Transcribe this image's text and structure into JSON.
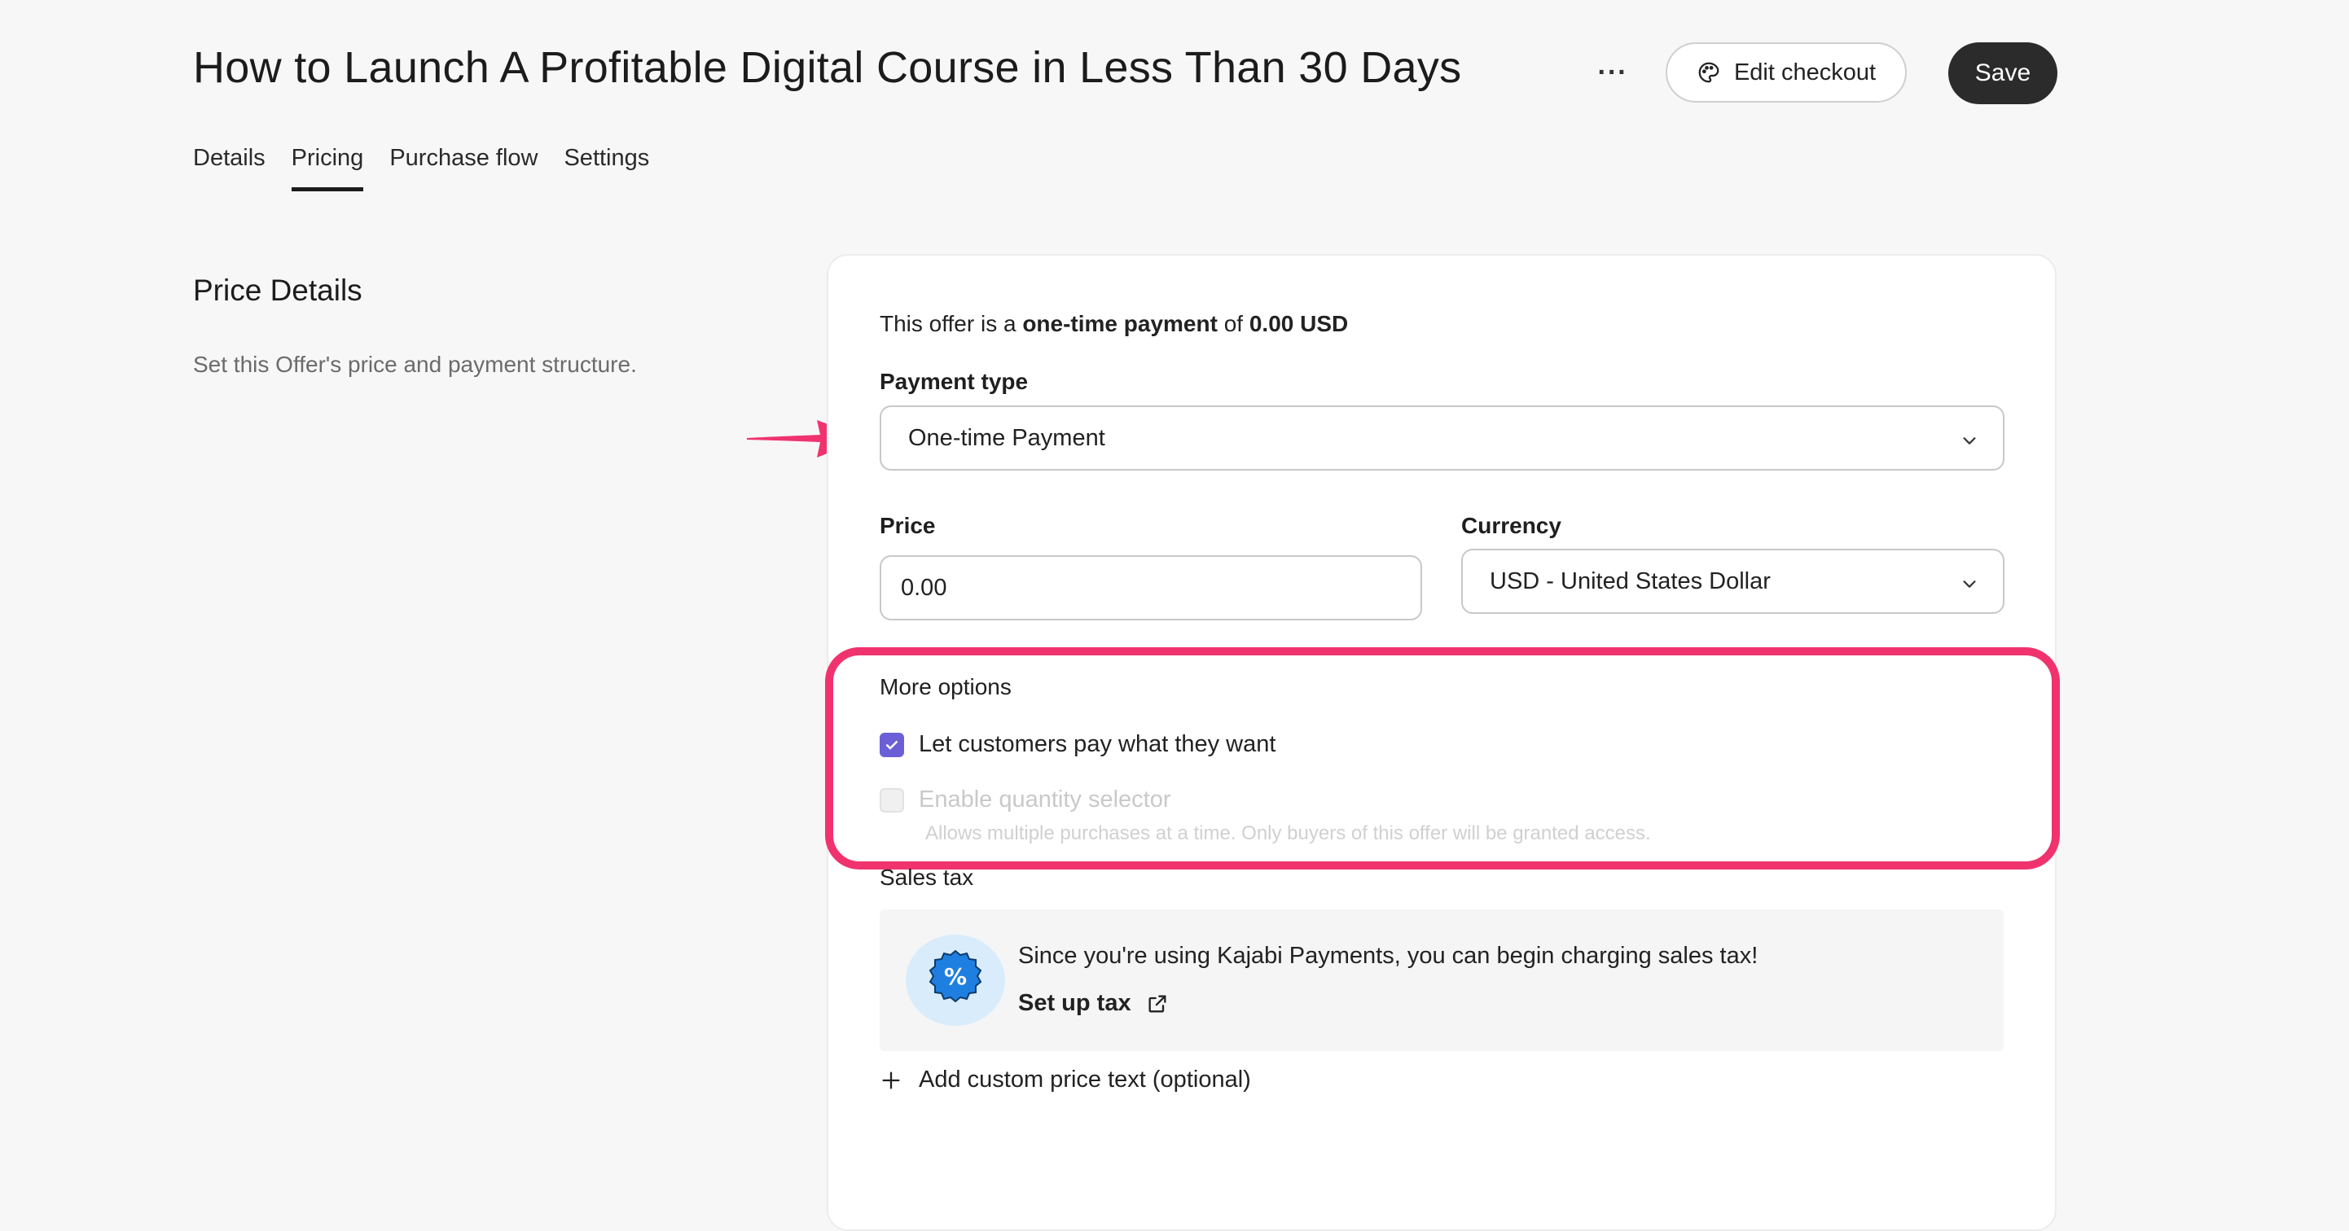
{
  "header": {
    "title": "How to Launch A Profitable Digital Course in Less Than 30 Days",
    "more_label": "···",
    "edit_checkout_label": "Edit checkout",
    "save_label": "Save"
  },
  "tabs": [
    {
      "label": "Details",
      "active": false
    },
    {
      "label": "Pricing",
      "active": true
    },
    {
      "label": "Purchase flow",
      "active": false
    },
    {
      "label": "Settings",
      "active": false
    }
  ],
  "section": {
    "title": "Price Details",
    "description": "Set this Offer's price and payment structure."
  },
  "summary": {
    "prefix": "This offer is a ",
    "type": "one-time payment",
    "middle": " of ",
    "amount": "0.00 USD"
  },
  "payment_type": {
    "label": "Payment type",
    "value": "One-time Payment"
  },
  "price": {
    "label": "Price",
    "value": "0.00"
  },
  "currency": {
    "label": "Currency",
    "value": "USD - United States Dollar"
  },
  "more_options": {
    "title": "More options",
    "pay_what_you_want": {
      "label": "Let customers pay what they want",
      "checked": true
    },
    "quantity_selector": {
      "label": "Enable quantity selector",
      "checked": false,
      "disabled": true,
      "help": "Allows multiple purchases at a time. Only buyers of this offer will be granted access."
    }
  },
  "sales_tax": {
    "label": "Sales tax",
    "badge_symbol": "%",
    "message": "Since you're using Kajabi Payments, you can begin charging sales tax!",
    "link_label": "Set up tax"
  },
  "add_custom_price_text": "Add custom price text (optional)",
  "colors": {
    "accent_highlight": "#f0336f",
    "checkbox_checked": "#6b5fd8",
    "save_button": "#2b2b2b",
    "tax_badge": "#1f7fe0"
  },
  "icons": {
    "annotation": "arrow-right-icon",
    "palette": "palette-icon",
    "select": "chevron-down-icon",
    "external": "external-link-icon",
    "add": "plus-icon",
    "badge": "percent-badge-icon"
  }
}
